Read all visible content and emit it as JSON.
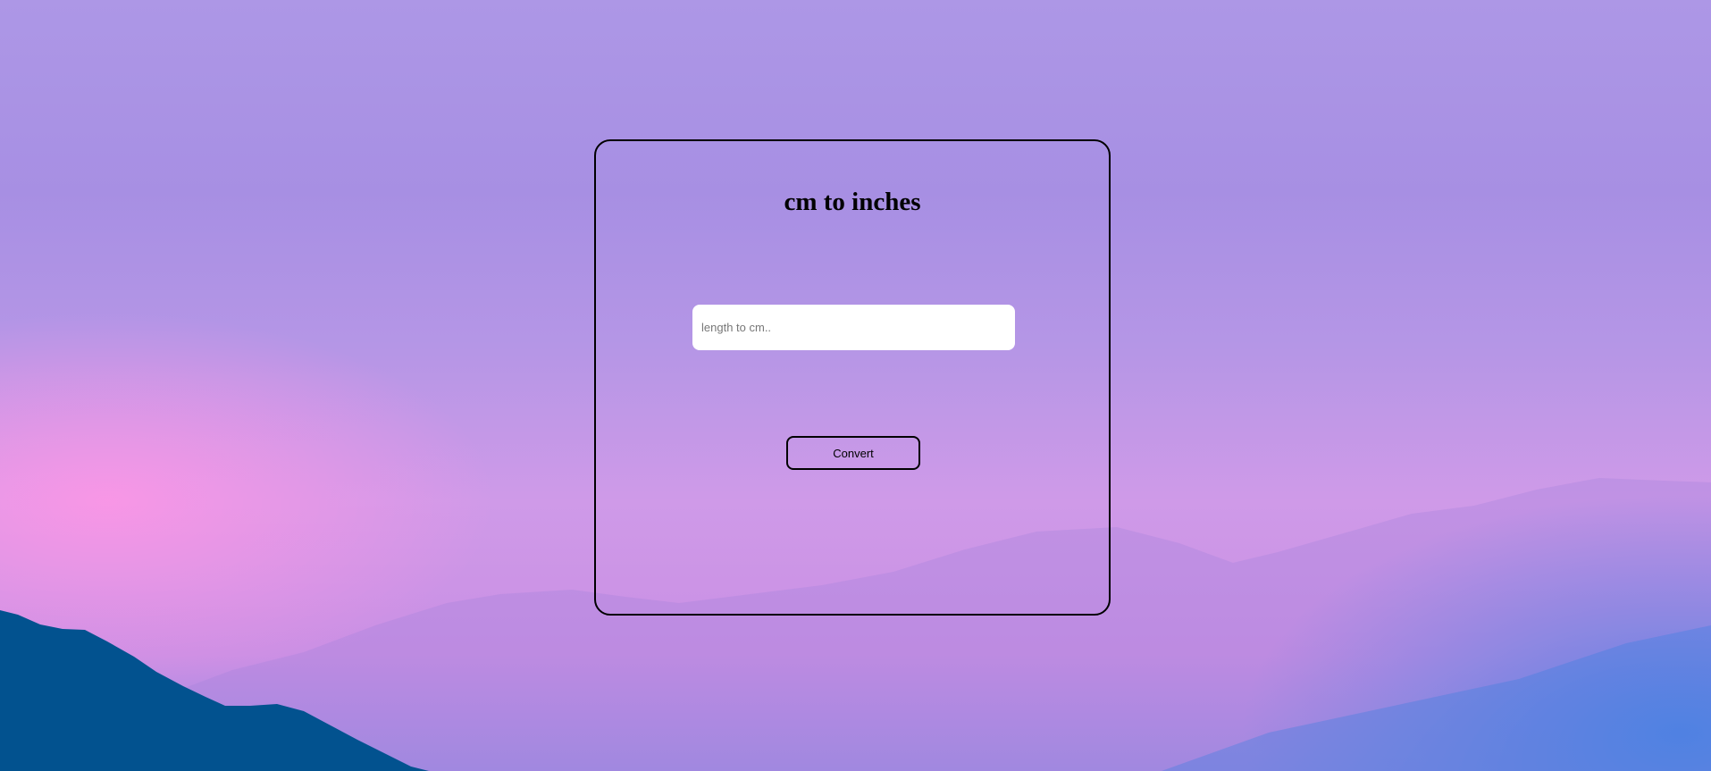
{
  "converter": {
    "title": "cm to inches",
    "input_placeholder": "length to cm..",
    "input_value": "",
    "button_label": "Convert"
  },
  "colors": {
    "sky_top": "#ad97e6",
    "sky_pink": "#ff96e6",
    "mountain_dark": "#004e94",
    "mountain_light": "#2a7fdc",
    "card_border": "#000000",
    "input_background": "#ffffff"
  }
}
